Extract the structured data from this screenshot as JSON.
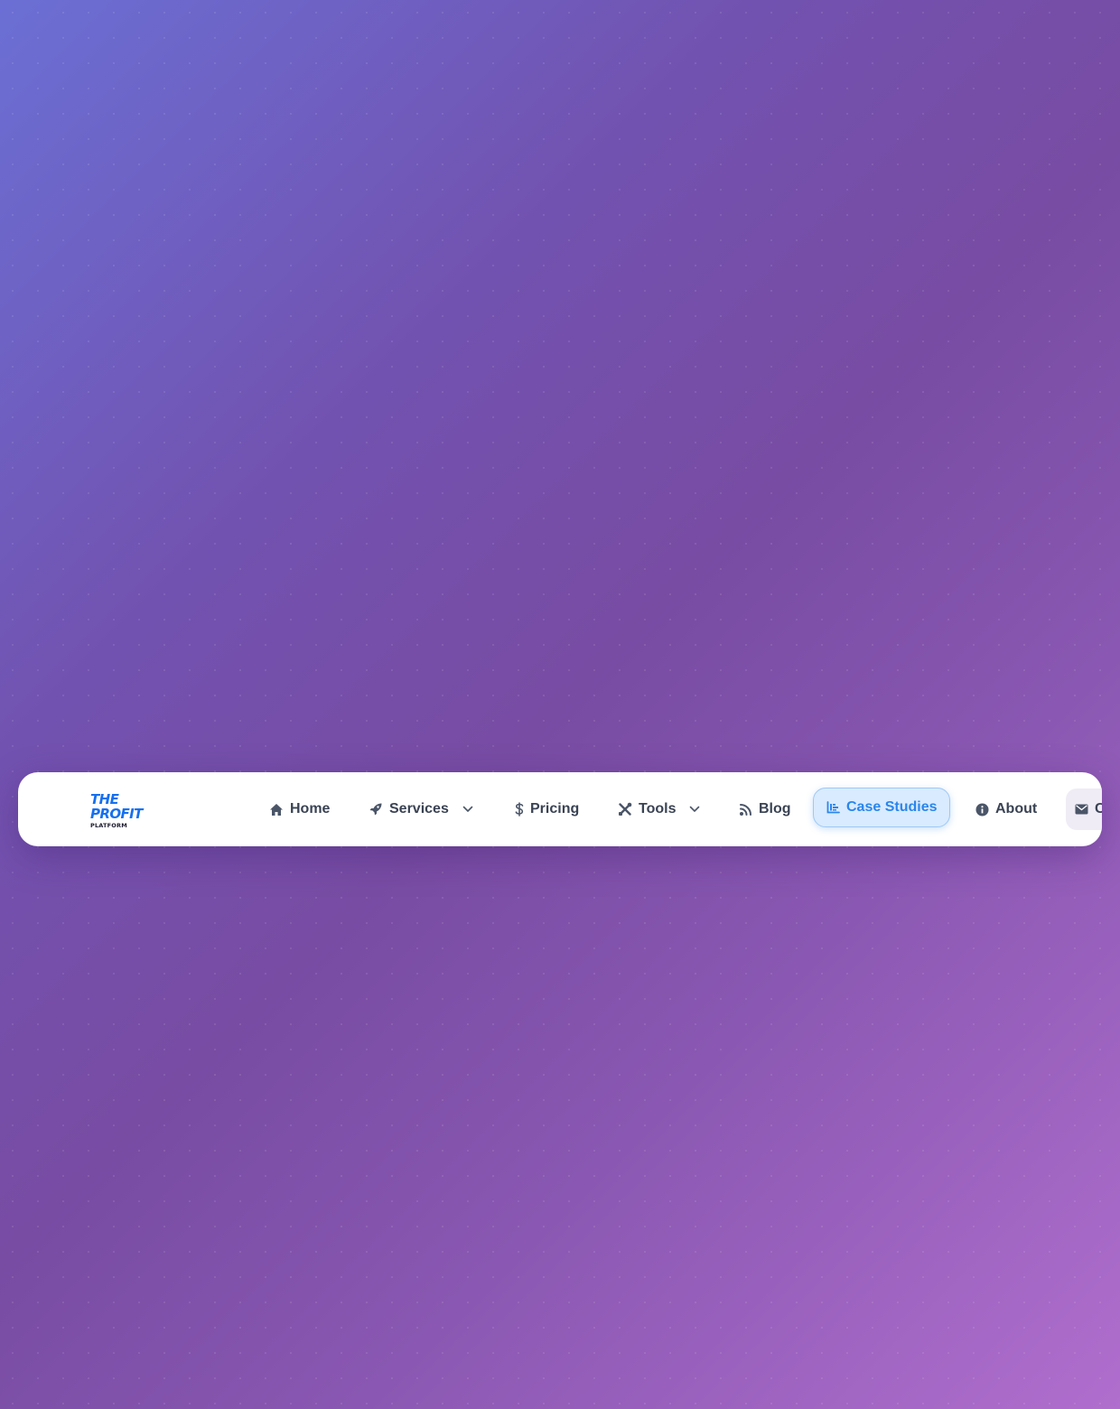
{
  "logo": {
    "line1": "THE",
    "line2": "PROFIT",
    "line3": "PLATFORM",
    "color": "#1570ef"
  },
  "nav": {
    "items": [
      {
        "label": "Home",
        "icon": "home-icon"
      },
      {
        "label": "Services",
        "icon": "rocket-icon",
        "dropdown": true
      },
      {
        "label": "Pricing",
        "icon": "dollar-icon"
      },
      {
        "label": "Tools",
        "icon": "tools-icon",
        "dropdown": true
      },
      {
        "label": "Blog",
        "icon": "blog-icon"
      },
      {
        "label": "Case Studies",
        "icon": "chart-icon",
        "active": true
      },
      {
        "label": "About",
        "icon": "info-icon"
      },
      {
        "label": "Con",
        "icon": "mail-icon"
      }
    ],
    "active_color": "#2b86ec",
    "text_color": "#3a4354"
  }
}
